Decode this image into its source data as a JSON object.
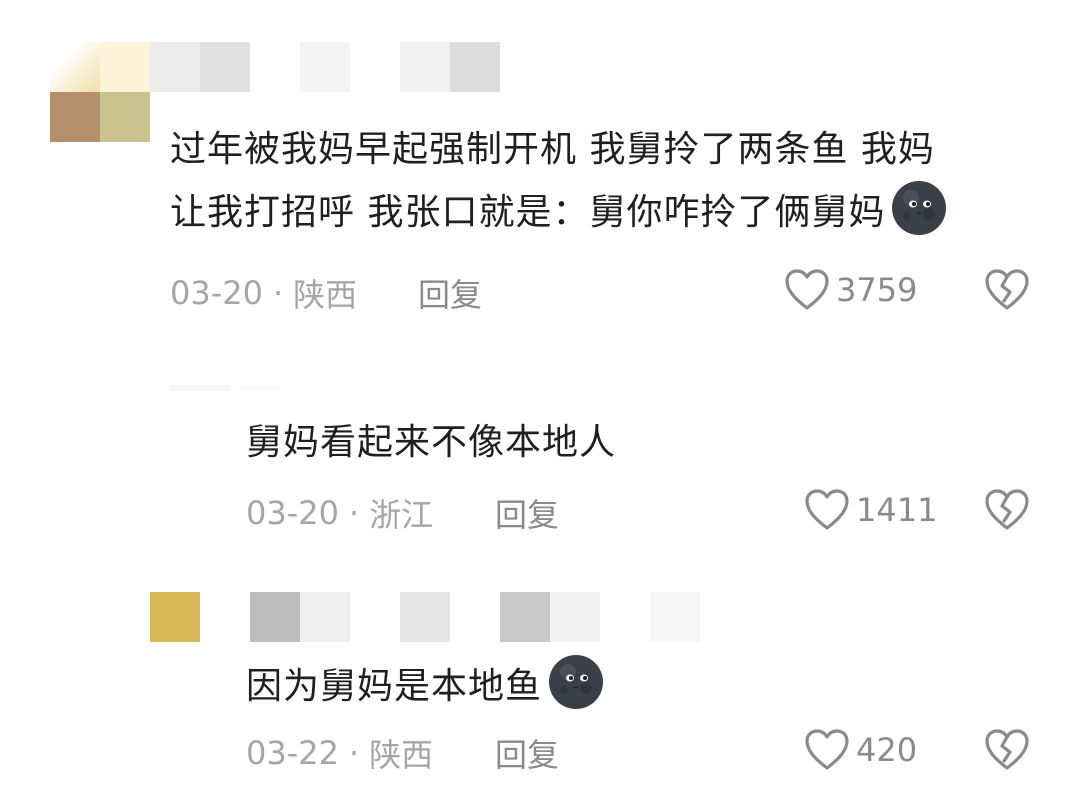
{
  "colors": {
    "text": "#1f1f1f",
    "meta": "#a6a6a6",
    "action": "#8a8a8a",
    "icon_stroke": "#8a8a8a"
  },
  "comments": [
    {
      "line1": "过年被我妈早起强制开机 我舅拎了两条鱼 我妈",
      "line2": "让我打招呼 我张口就是：舅你咋拎了俩舅妈",
      "emoji": "new-moon-face",
      "date": "03-20",
      "separator": "·",
      "location": "陕西",
      "reply_label": "回复",
      "likes": "3759"
    },
    {
      "text": "舅妈看起来不像本地人",
      "date": "03-20",
      "separator": "·",
      "location": "浙江",
      "reply_label": "回复",
      "likes": "1411"
    },
    {
      "text": "因为舅妈是本地鱼",
      "emoji": "new-moon-face",
      "date": "03-22",
      "separator": "·",
      "location": "陕西",
      "reply_label": "回复",
      "likes": "420"
    }
  ]
}
